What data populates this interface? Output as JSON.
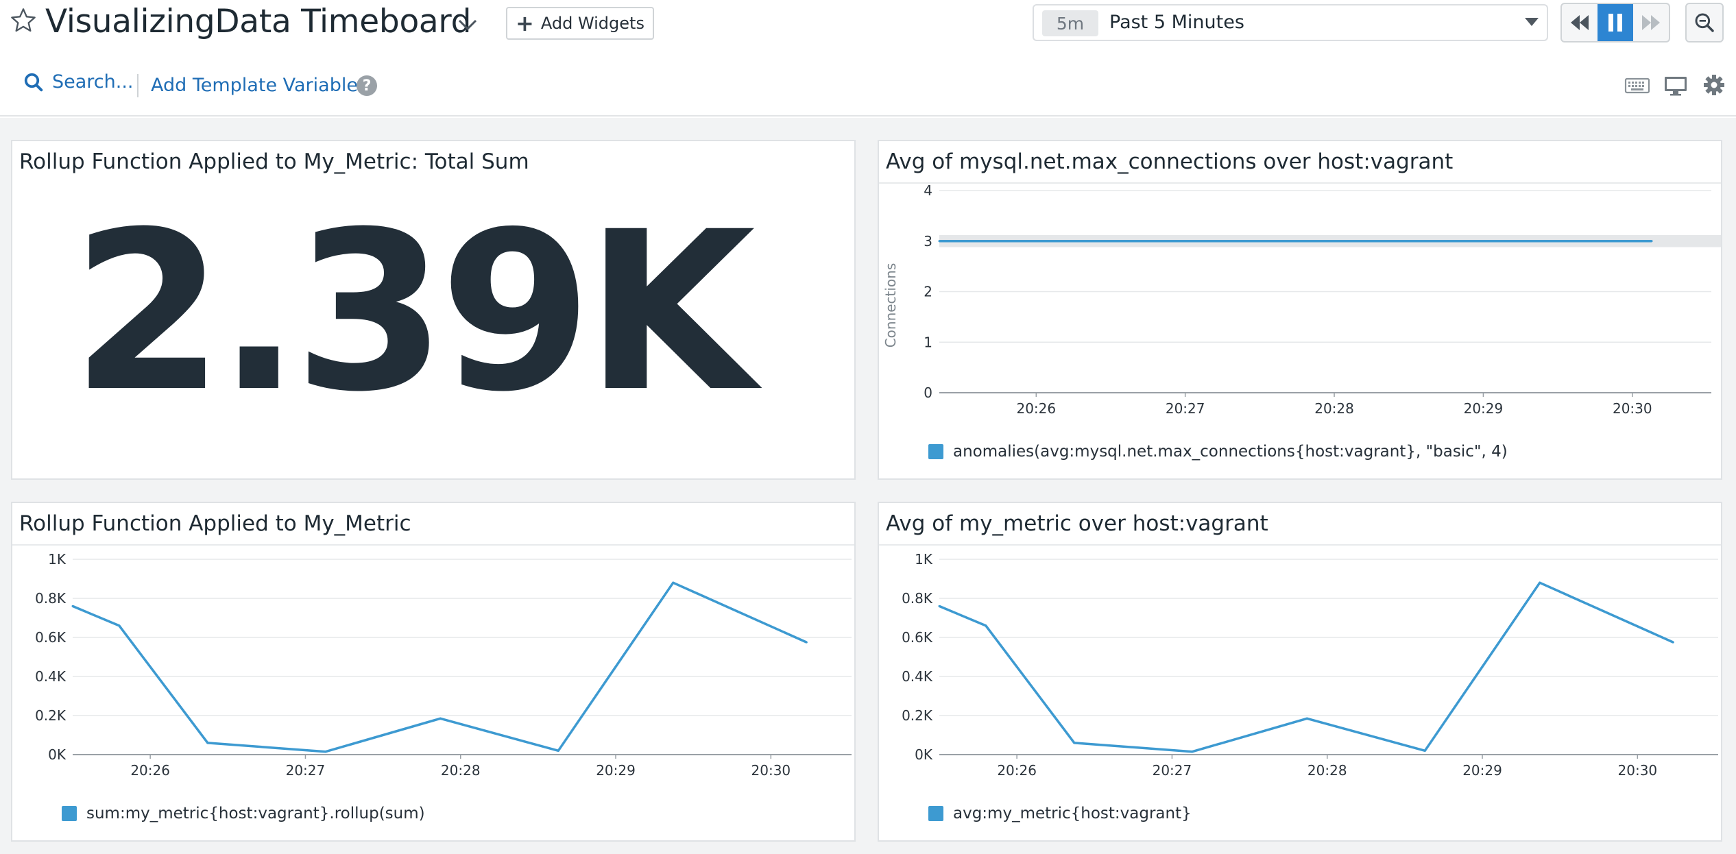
{
  "header": {
    "title": "VisualizingData Timeboard",
    "add_widgets_label": "Add Widgets",
    "timeframe_chip": "5m",
    "timeframe_label": "Past 5 Minutes",
    "search_label": "Search...",
    "template_vars_label": "Add Template Variables",
    "help_glyph": "?"
  },
  "colors": {
    "accent": "#2d85d2",
    "link": "#1f6db5",
    "series": "#3d9ad1",
    "band": "#e5e7e9"
  },
  "widgets": {
    "query_value": {
      "title": "Rollup Function Applied to My_Metric: Total Sum",
      "value": "2.39K"
    },
    "mysql": {
      "title": "Avg of mysql.net.max_connections over host:vagrant",
      "legend": "anomalies(avg:mysql.net.max_connections{host:vagrant}, \"basic\", 4)"
    },
    "rollup": {
      "title": "Rollup Function Applied to My_Metric",
      "legend": "sum:my_metric{host:vagrant}.rollup(sum)"
    },
    "avg_metric": {
      "title": "Avg of my_metric over host:vagrant",
      "legend": "avg:my_metric{host:vagrant}"
    }
  },
  "chart_data": [
    {
      "type": "line",
      "title": "Avg of mysql.net.max_connections over host:vagrant",
      "ylabel": "Connections",
      "xlabel": "",
      "ylim": [
        0,
        4
      ],
      "yticks": [
        "0",
        "1",
        "2",
        "3",
        "4"
      ],
      "xticks": [
        "20:26",
        "20:27",
        "20:28",
        "20:29",
        "20:30"
      ],
      "xlim_minutes": [
        25.35,
        30.53
      ],
      "grid": true,
      "legend_position": "bottom",
      "anomaly_band": [
        2.88,
        3.12
      ],
      "series": [
        {
          "name": "anomalies(avg:mysql.net.max_connections{host:vagrant}, \"basic\", 4)",
          "x": [
            25.35,
            30.13
          ],
          "values": [
            3,
            3
          ]
        }
      ]
    },
    {
      "type": "line",
      "title": "Rollup Function Applied to My_Metric",
      "xlabel": "",
      "ylabel": "",
      "ylim": [
        0,
        1000
      ],
      "yticks": [
        "0K",
        "0.2K",
        "0.4K",
        "0.6K",
        "0.8K",
        "1K"
      ],
      "xticks": [
        "20:26",
        "20:27",
        "20:28",
        "20:29",
        "20:30"
      ],
      "xlim_minutes": [
        25.5,
        30.52
      ],
      "grid": true,
      "legend_position": "bottom",
      "series": [
        {
          "name": "sum:my_metric{host:vagrant}.rollup(sum)",
          "x": [
            25.5,
            25.8,
            26.37,
            27.13,
            27.87,
            28.63,
            29.37,
            30.23
          ],
          "values": [
            760,
            660,
            60,
            15,
            185,
            20,
            880,
            575
          ]
        }
      ]
    },
    {
      "type": "line",
      "title": "Avg of my_metric over host:vagrant",
      "xlabel": "",
      "ylabel": "",
      "ylim": [
        0,
        1000
      ],
      "yticks": [
        "0K",
        "0.2K",
        "0.4K",
        "0.6K",
        "0.8K",
        "1K"
      ],
      "xticks": [
        "20:26",
        "20:27",
        "20:28",
        "20:29",
        "20:30"
      ],
      "xlim_minutes": [
        25.5,
        30.52
      ],
      "grid": true,
      "legend_position": "bottom",
      "series": [
        {
          "name": "avg:my_metric{host:vagrant}",
          "x": [
            25.5,
            25.8,
            26.37,
            27.13,
            27.87,
            28.63,
            29.37,
            30.23
          ],
          "values": [
            760,
            660,
            60,
            15,
            185,
            20,
            880,
            575
          ]
        }
      ]
    }
  ]
}
